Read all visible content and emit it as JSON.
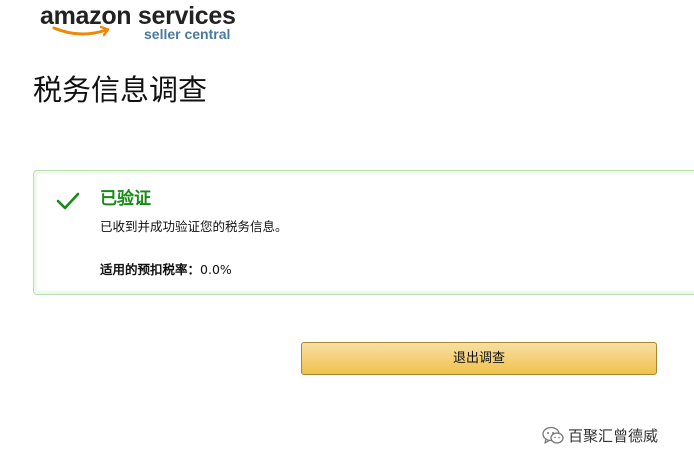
{
  "logo": {
    "brand_text": "amazon services",
    "sub_text": "seller central"
  },
  "page": {
    "title": "税务信息调查"
  },
  "alert": {
    "icon": "checkmark-icon",
    "heading": "已验证",
    "message": "已收到并成功验证您的税务信息。",
    "rate_label": "适用的预扣税率：",
    "rate_value": "0.0%"
  },
  "actions": {
    "exit_label": "退出调查"
  },
  "watermark": {
    "icon": "wechat-icon",
    "text": "百聚汇曾德威"
  },
  "colors": {
    "success_green": "#178a17",
    "alert_border": "#b9dfb1",
    "button_gold": "#f0c14b",
    "logo_sub_blue": "#4a7a9c",
    "smile_orange": "#f08804"
  }
}
